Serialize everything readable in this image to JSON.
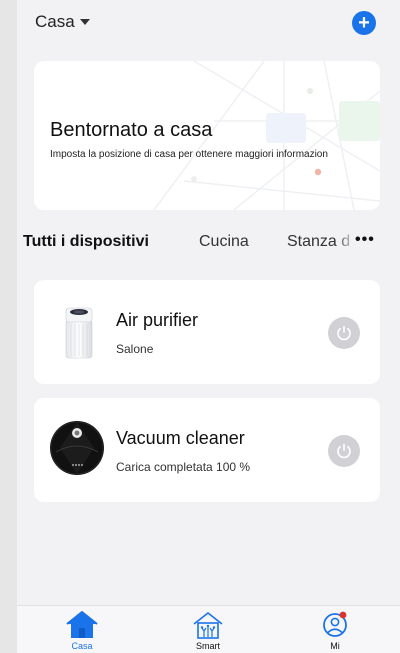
{
  "header": {
    "home_name": "Casa",
    "home_dropdown_icon": "caret-down-icon",
    "add_icon": "plus-icon",
    "accent_color": "#1a73e8"
  },
  "welcome": {
    "title": "Bentornato a casa",
    "subtitle": "Imposta la posizione di casa per ottenere maggiori informazion"
  },
  "tabs": [
    {
      "label": "Tutti i dispositivi",
      "active": true
    },
    {
      "label": "Cucina",
      "active": false
    },
    {
      "label": "Stanza d",
      "active": false
    }
  ],
  "tabs_more_label": "•••",
  "devices": [
    {
      "name": "Air purifier",
      "subtitle": "Salone",
      "icon": "air-purifier-icon",
      "power_icon": "power-icon"
    },
    {
      "name": "Vacuum cleaner",
      "subtitle": "Carica completata  100 %",
      "icon": "robot-vacuum-icon",
      "power_icon": "power-icon"
    }
  ],
  "bottom_nav": [
    {
      "label": "Casa",
      "icon": "home-icon",
      "active": true
    },
    {
      "label": "Smart",
      "icon": "smart-home-icon",
      "active": false
    },
    {
      "label": "Mi",
      "icon": "profile-icon",
      "active": false,
      "badge": true
    }
  ]
}
